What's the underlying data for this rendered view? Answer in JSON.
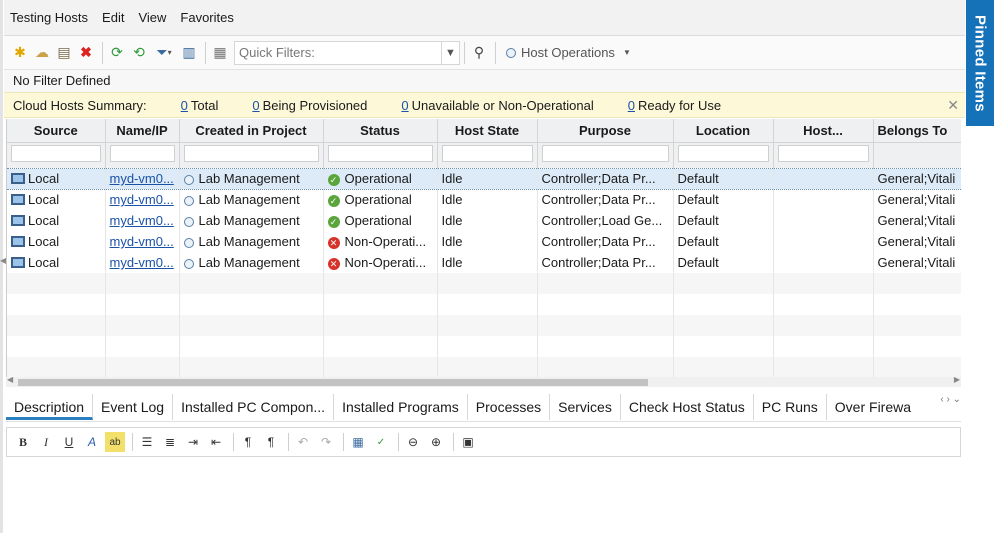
{
  "menu": [
    "Testing Hosts",
    "Edit",
    "View",
    "Favorites"
  ],
  "toolbar": {
    "quick_filters_placeholder": "Quick Filters:",
    "host_operations": "Host Operations"
  },
  "filter_status": "No Filter Defined",
  "summary": {
    "label": "Cloud Hosts Summary:",
    "items": [
      {
        "count": "0",
        "label": "Total"
      },
      {
        "count": "0",
        "label": "Being Provisioned"
      },
      {
        "count": "0",
        "label": "Unavailable or Non-Operational"
      },
      {
        "count": "0",
        "label": "Ready for Use"
      }
    ]
  },
  "grid": {
    "columns": [
      "Source",
      "Name/IP",
      "Created in Project",
      "Status",
      "Host State",
      "Purpose",
      "Location",
      "Host...",
      "Belongs To"
    ],
    "rows": [
      {
        "source": "Local",
        "name": "myd-vm0...",
        "project": "Lab Management",
        "status": "Operational",
        "status_ok": true,
        "state": "Idle",
        "purpose": "Controller;Data Pr...",
        "location": "Default",
        "host": "",
        "belongs": "General;Vitali"
      },
      {
        "source": "Local",
        "name": "myd-vm0...",
        "project": "Lab Management",
        "status": "Operational",
        "status_ok": true,
        "state": "Idle",
        "purpose": "Controller;Data Pr...",
        "location": "Default",
        "host": "",
        "belongs": "General;Vitali"
      },
      {
        "source": "Local",
        "name": "myd-vm0...",
        "project": "Lab Management",
        "status": "Operational",
        "status_ok": true,
        "state": "Idle",
        "purpose": "Controller;Load Ge...",
        "location": "Default",
        "host": "",
        "belongs": "General;Vitali"
      },
      {
        "source": "Local",
        "name": "myd-vm0...",
        "project": "Lab Management",
        "status": "Non-Operati...",
        "status_ok": false,
        "state": "Idle",
        "purpose": "Controller;Data Pr...",
        "location": "Default",
        "host": "",
        "belongs": "General;Vitali"
      },
      {
        "source": "Local",
        "name": "myd-vm0...",
        "project": "Lab Management",
        "status": "Non-Operati...",
        "status_ok": false,
        "state": "Idle",
        "purpose": "Controller;Data Pr...",
        "location": "Default",
        "host": "",
        "belongs": "General;Vitali"
      }
    ]
  },
  "tabs": [
    "Description",
    "Event Log",
    "Installed PC Compon...",
    "Installed Programs",
    "Processes",
    "Services",
    "Check Host Status",
    "PC Runs",
    "Over Firewa"
  ],
  "pinned": "Pinned Items",
  "colors": {
    "accent": "#1571b8",
    "summary_bg": "#fcf8d8",
    "selected_row": "#dcebf7",
    "ok": "#5aa63c",
    "error": "#d6332a"
  }
}
